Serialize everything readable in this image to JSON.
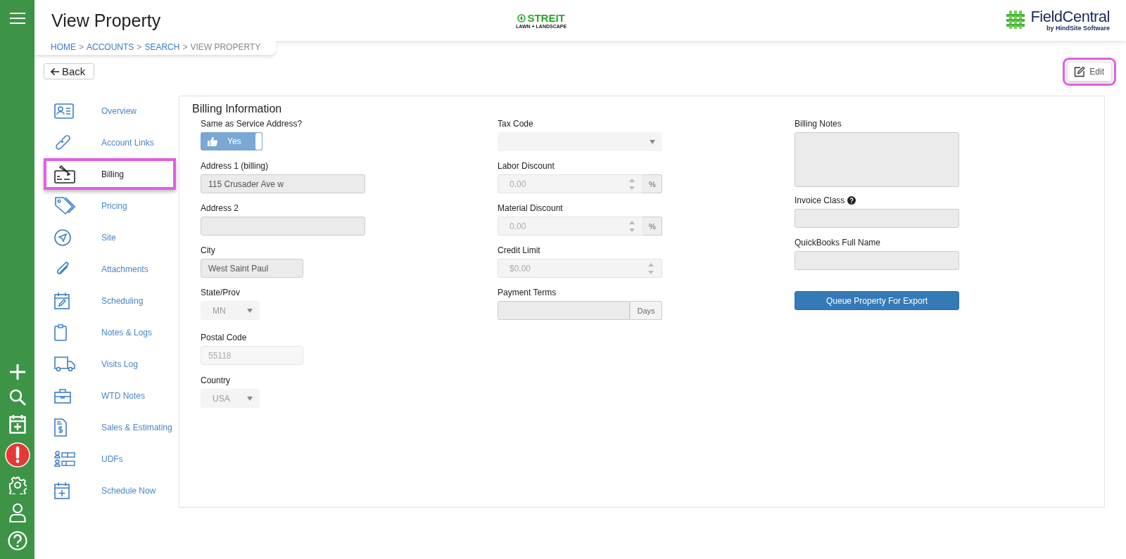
{
  "header": {
    "title": "View Property",
    "breadcrumb": [
      {
        "label": "HOME",
        "link": true
      },
      {
        "label": "ACCOUNTS",
        "link": true
      },
      {
        "label": "SEARCH",
        "link": true
      },
      {
        "label": "VIEW PROPERTY",
        "link": false
      }
    ],
    "separator": ">",
    "brand": {
      "name": "STREIT",
      "tagline": "LAWN + LANDSCAPE"
    },
    "vendor": {
      "name": "FieldCentral",
      "tagline": "by HindSite Software"
    }
  },
  "back_button": {
    "label": "Back"
  },
  "edit_button": {
    "label": "Edit",
    "highlighted": true
  },
  "nav": [
    {
      "label": "Overview",
      "selected": false,
      "highlighted": false
    },
    {
      "label": "Account Links",
      "selected": false,
      "highlighted": false
    },
    {
      "label": "Billing",
      "selected": true,
      "highlighted": true
    },
    {
      "label": "Pricing",
      "selected": false,
      "highlighted": false
    },
    {
      "label": "Site",
      "selected": false,
      "highlighted": false
    },
    {
      "label": "Attachments",
      "selected": false,
      "highlighted": false
    },
    {
      "label": "Scheduling",
      "selected": false,
      "highlighted": false
    },
    {
      "label": "Notes & Logs",
      "selected": false,
      "highlighted": false
    },
    {
      "label": "Visits Log",
      "selected": false,
      "highlighted": false
    },
    {
      "label": "WTD Notes",
      "selected": false,
      "highlighted": false
    },
    {
      "label": "Sales & Estimating",
      "selected": false,
      "highlighted": false
    },
    {
      "label": "UDFs",
      "selected": false,
      "highlighted": false
    },
    {
      "label": "Schedule Now",
      "selected": false,
      "highlighted": false
    }
  ],
  "billing": {
    "title": "Billing Information",
    "columns": [
      [
        {
          "kind": "toggle",
          "label": "Same as Service Address?",
          "value": "Yes",
          "on": true
        },
        {
          "kind": "text",
          "label": "Address 1 (billing)",
          "value": "115 Crusader Ave w",
          "disabled": false
        },
        {
          "kind": "text",
          "label": "Address 2",
          "disabled": false
        },
        {
          "kind": "text",
          "label": "City",
          "value": "West Saint Paul",
          "disabled": false
        },
        {
          "kind": "select",
          "label": "State/Prov",
          "value": "MN"
        },
        {
          "kind": "text",
          "label": "Postal Code",
          "value": "55118",
          "disabled": true
        },
        {
          "kind": "select",
          "label": "Country",
          "value": "USA"
        }
      ],
      [
        {
          "kind": "select",
          "label": "Tax Code"
        },
        {
          "kind": "number",
          "label": "Labor Discount",
          "value": "0.00",
          "unit": "%"
        },
        {
          "kind": "number",
          "label": "Material Discount",
          "value": "0.00",
          "unit": "%"
        },
        {
          "kind": "number",
          "label": "Credit Limit",
          "value": "$0.00"
        },
        {
          "kind": "unit",
          "label": "Payment Terms",
          "unit": "Days"
        }
      ],
      [
        {
          "kind": "textarea",
          "label": "Billing Notes"
        },
        {
          "kind": "text",
          "label": "Invoice Class",
          "help": true,
          "disabled": false
        },
        {
          "kind": "text",
          "label": "QuickBooks Full Name",
          "disabled": false
        },
        {
          "kind": "button",
          "label": "Queue Property For Export"
        }
      ]
    ]
  }
}
